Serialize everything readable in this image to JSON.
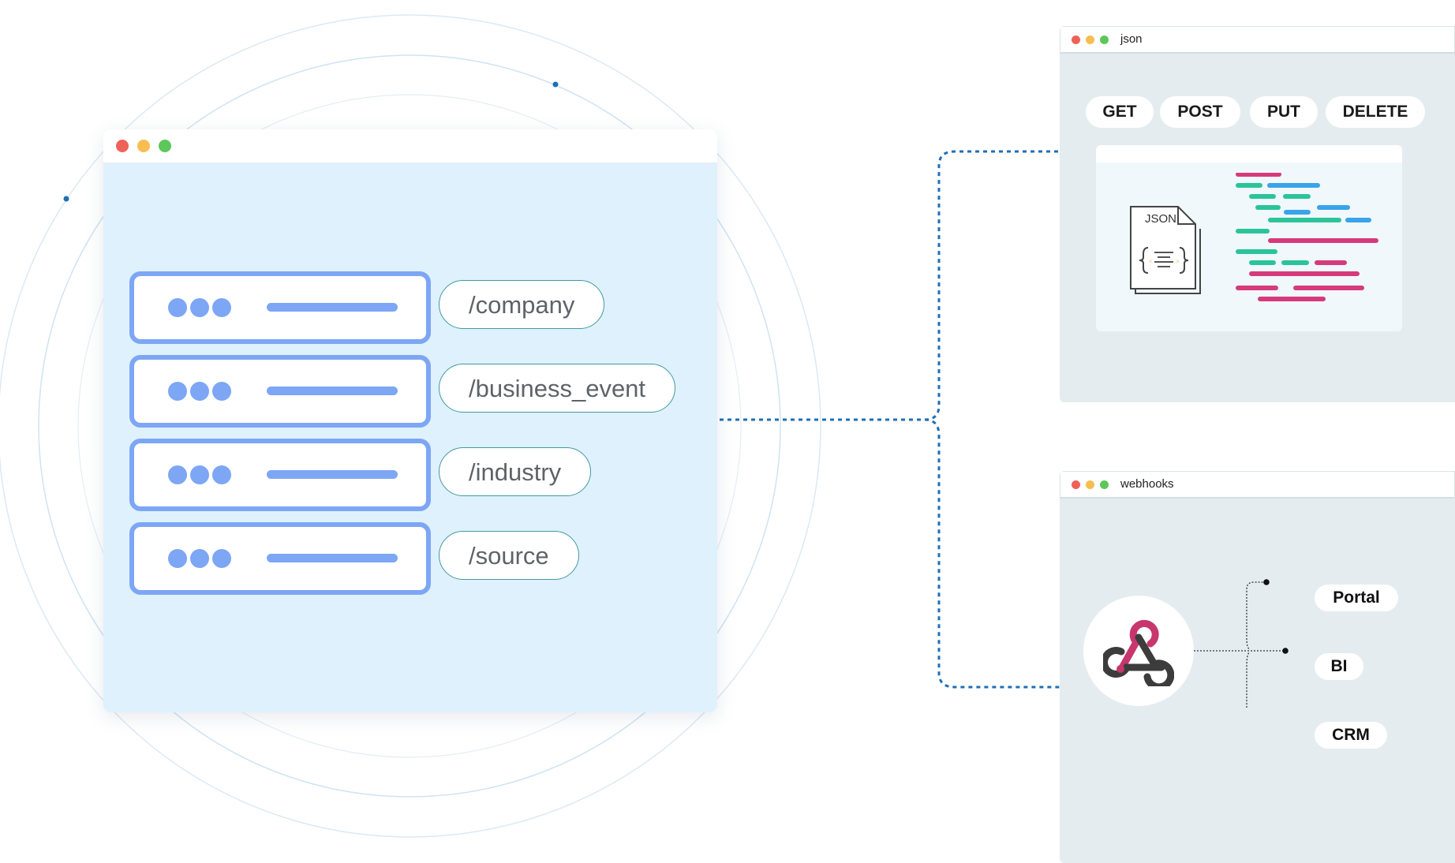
{
  "main_window": {
    "routes": [
      "/company",
      "/business_event",
      "/industry",
      "/source"
    ]
  },
  "json_window": {
    "title": "json",
    "methods": [
      "GET",
      "POST",
      "PUT",
      "DELETE"
    ],
    "file_icon_label": "JSON"
  },
  "webhooks_window": {
    "title": "webhooks",
    "targets": [
      "Portal",
      "BI",
      "CRM"
    ]
  },
  "colors": {
    "window_close": "#ee6259",
    "window_minimize": "#f6be4f",
    "window_maximize": "#5cc75a",
    "route_accent": "#7da6f5",
    "pill_border": "#3f9aa0",
    "connector": "#1f6fb5",
    "code_pink": "#d63a7c",
    "code_green": "#2bc49a",
    "code_blue": "#3aa3ea",
    "webhook_pink": "#c8366e",
    "webhook_dark": "#3c3c3c"
  },
  "icons": {
    "json_file": "json-file-icon",
    "webhook": "webhook-icon"
  }
}
